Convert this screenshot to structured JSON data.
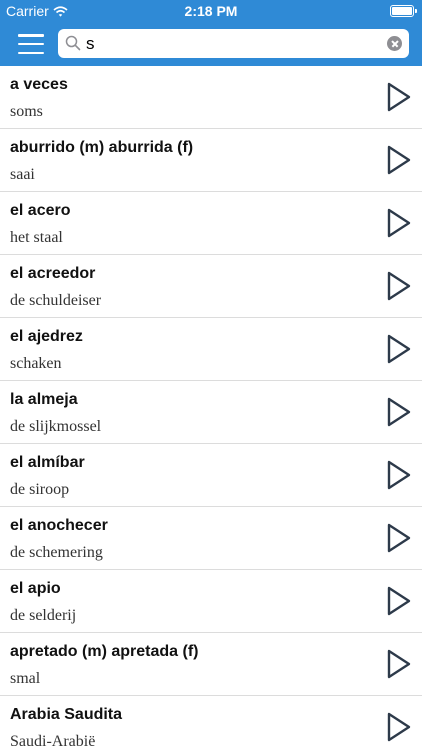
{
  "status_bar": {
    "carrier": "Carrier",
    "time": "2:18 PM"
  },
  "search": {
    "value": "s",
    "placeholder": ""
  },
  "icons": {
    "menu": "hamburger-menu-icon",
    "search": "magnifier-icon",
    "clear": "clear-circle-icon",
    "play": "play-triangle-icon",
    "wifi": "wifi-icon",
    "battery": "battery-icon"
  },
  "colors": {
    "header": "#2f8ad6",
    "icon_stroke": "#2d3a4a",
    "separator": "#dcdcdc"
  },
  "entries": [
    {
      "term": "a veces",
      "translation": "soms"
    },
    {
      "term": "aburrido (m)  aburrida (f)",
      "translation": "saai"
    },
    {
      "term": "el acero",
      "translation": "het staal"
    },
    {
      "term": "el acreedor",
      "translation": "de schuldeiser"
    },
    {
      "term": "el ajedrez",
      "translation": "schaken"
    },
    {
      "term": "la almeja",
      "translation": "de slijkmossel"
    },
    {
      "term": "el almíbar",
      "translation": "de siroop"
    },
    {
      "term": "el anochecer",
      "translation": "de schemering"
    },
    {
      "term": "el apio",
      "translation": "de selderij"
    },
    {
      "term": "apretado (m)  apretada (f)",
      "translation": "smal"
    },
    {
      "term": "Arabia Saudita",
      "translation": "Saudi-Arabië"
    }
  ]
}
